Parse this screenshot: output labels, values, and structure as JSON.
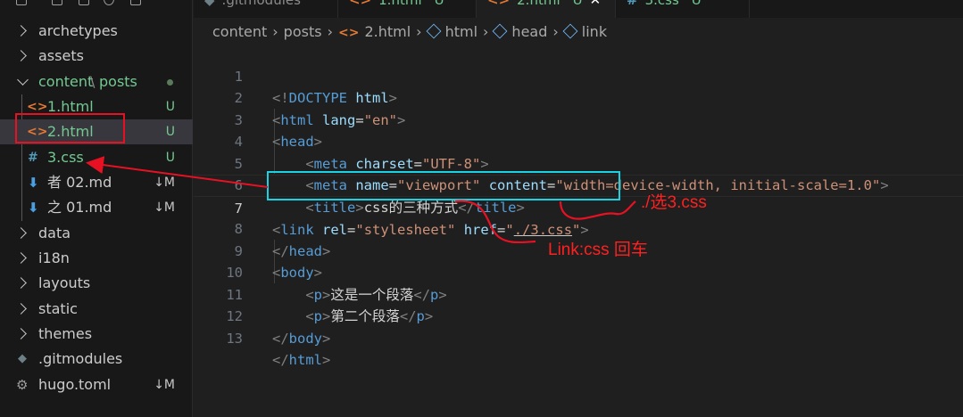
{
  "tabs": [
    {
      "label": ".gitmodules",
      "icon": "gear-icon"
    },
    {
      "label": "1.html",
      "icon": "html-file-icon",
      "status": "U"
    },
    {
      "label": "2.html",
      "icon": "html-file-icon",
      "status": "U",
      "active": true
    },
    {
      "label": "3.css",
      "icon": "css-file-icon",
      "status": "U"
    }
  ],
  "explorer": {
    "items": [
      {
        "label": "archetypes",
        "type": "folder"
      },
      {
        "label": "assets",
        "type": "folder"
      },
      {
        "label": "content",
        "sep": "\\",
        "label2": "posts",
        "type": "folder-open"
      },
      {
        "label": "1.html",
        "status": "U",
        "icon": "<>"
      },
      {
        "label": "2.html",
        "status": "U",
        "icon": "<>"
      },
      {
        "label": "3.css",
        "status": "U",
        "icon": "#"
      },
      {
        "label": "者   02.md",
        "status": "↓M"
      },
      {
        "label": "之   01.md",
        "status": "↓M"
      },
      {
        "label": "data",
        "type": "folder"
      },
      {
        "label": "i18n",
        "type": "folder"
      },
      {
        "label": "layouts",
        "type": "folder"
      },
      {
        "label": "static",
        "type": "folder"
      },
      {
        "label": "themes",
        "type": "folder"
      },
      {
        "label": ".gitmodules"
      },
      {
        "label": "hugo.toml",
        "status": "↓M"
      }
    ]
  },
  "breadcrumb": {
    "items": [
      "content",
      "posts",
      "2.html",
      "html",
      "head",
      "link"
    ]
  },
  "editor": {
    "line_numbers": [
      "1",
      "2",
      "3",
      "4",
      "5",
      "6",
      "7",
      "8",
      "9",
      "10",
      "11",
      "12",
      "13"
    ],
    "lines": {
      "l1": {
        "open": "<!",
        "tag": "DOCTYPE",
        "sp": " ",
        "attr": "html",
        "close": ">"
      },
      "l2": {
        "open": "<",
        "tag": "html",
        "sp": " ",
        "attr": "lang",
        "eq": "=",
        "val": "\"en\"",
        "close": ">"
      },
      "l3": {
        "open": "<",
        "tag": "head",
        "close": ">"
      },
      "l4": {
        "indent": "    ",
        "open": "<",
        "tag": "meta",
        "sp": " ",
        "attr": "charset",
        "eq": "=",
        "val": "\"UTF-8\"",
        "close": ">"
      },
      "l5": {
        "indent": "    ",
        "open": "<",
        "tag": "meta",
        "sp": " ",
        "attr": "name",
        "eq": "=",
        "val": "\"viewport\"",
        "sp2": " ",
        "attr2": "content",
        "eq2": "=",
        "val2": "\"width=device-width, initial-scale=1.0\"",
        "close": ">"
      },
      "l6": {
        "indent": "    ",
        "open": "<",
        "tag": "title",
        "close": ">",
        "text": "css的三种方式",
        "open2": "</",
        "tag2": "title",
        "close2": ">"
      },
      "l7": {
        "open": "<",
        "tag": "link",
        "sp": " ",
        "attr": "rel",
        "eq": "=",
        "val": "\"stylesheet\"",
        "sp2": " ",
        "attr2": "href",
        "eq2": "=",
        "q": "\"",
        "val2u": "./3.css",
        "q2": "\"",
        "close": ">"
      },
      "l8": {
        "open": "</",
        "tag": "head",
        "close": ">"
      },
      "l9": {
        "open": "<",
        "tag": "body",
        "close": ">"
      },
      "l10": {
        "indent": "    ",
        "open": "<",
        "tag": "p",
        "close": ">",
        "text": "这是一个段落",
        "open2": "</",
        "tag2": "p",
        "close2": ">"
      },
      "l11": {
        "indent": "    ",
        "open": "<",
        "tag": "p",
        "close": ">",
        "text": "第二个段落",
        "open2": "</",
        "tag2": "p",
        "close2": ">"
      },
      "l12": {
        "open": "</",
        "tag": "body",
        "close": ">"
      },
      "l13": {
        "open": "</",
        "tag": "html",
        "close": ">"
      }
    }
  },
  "annotations": {
    "note_href": "./选3.css",
    "note_link": "Link:css 回车"
  },
  "colors": {
    "annotation_red": "#e81123",
    "annotation_cyan": "#19d3e5",
    "git_untracked": "#73c991",
    "git_modified": "#c5c5c5",
    "html_icon": "#e37933",
    "css_icon": "#519aba",
    "editor_bg": "#1f1f1f",
    "sidebar_bg": "#181818"
  }
}
